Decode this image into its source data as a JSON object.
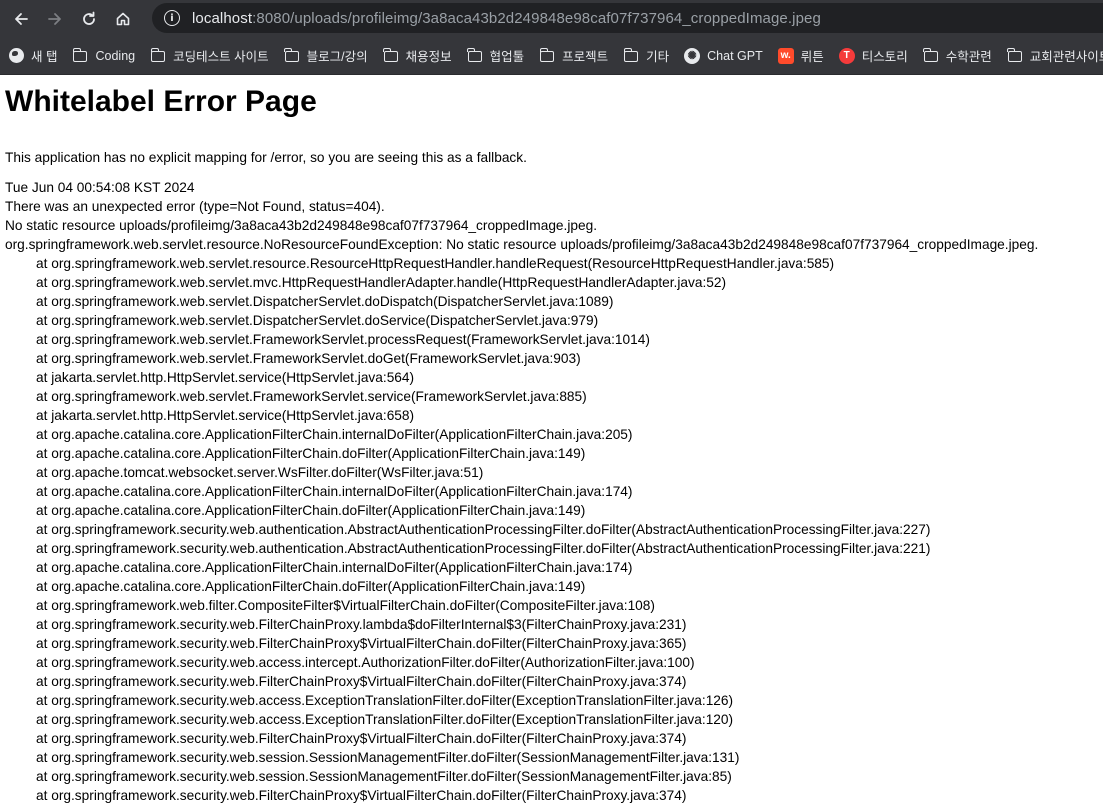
{
  "browser": {
    "url_host": "localhost",
    "url_rest": ":8080/uploads/profileimg/3a8aca43b2d249848e98caf07f737964_croppedImage.jpeg",
    "bookmarks": [
      {
        "label": "새 탭",
        "icon": "globe-icon"
      },
      {
        "label": "Coding",
        "icon": "folder-icon"
      },
      {
        "label": "코딩테스트 사이트",
        "icon": "folder-icon"
      },
      {
        "label": "블로그/강의",
        "icon": "folder-icon"
      },
      {
        "label": "채용정보",
        "icon": "folder-icon"
      },
      {
        "label": "협업툴",
        "icon": "folder-icon"
      },
      {
        "label": "프로젝트",
        "icon": "folder-icon"
      },
      {
        "label": "기타",
        "icon": "folder-icon"
      },
      {
        "label": "Chat GPT",
        "icon": "chatgpt-icon"
      },
      {
        "label": "뤼튼",
        "icon": "wrtn-icon"
      },
      {
        "label": "티스토리",
        "icon": "tistory-icon"
      },
      {
        "label": "수학관련",
        "icon": "folder-icon"
      },
      {
        "label": "교회관련사이트",
        "icon": "folder-icon"
      }
    ]
  },
  "page": {
    "title": "Whitelabel Error Page",
    "fallback": "This application has no explicit mapping for /error, so you are seeing this as a fallback.",
    "timestamp": "Tue Jun 04 00:54:08 KST 2024",
    "error_line": "There was an unexpected error (type=Not Found, status=404).",
    "message": "No static resource uploads/profileimg/3a8aca43b2d249848e98caf07f737964_croppedImage.jpeg.",
    "exception": "org.springframework.web.servlet.resource.NoResourceFoundException: No static resource uploads/profileimg/3a8aca43b2d249848e98caf07f737964_croppedImage.jpeg.",
    "stack_trace": [
      "at org.springframework.web.servlet.resource.ResourceHttpRequestHandler.handleRequest(ResourceHttpRequestHandler.java:585)",
      "at org.springframework.web.servlet.mvc.HttpRequestHandlerAdapter.handle(HttpRequestHandlerAdapter.java:52)",
      "at org.springframework.web.servlet.DispatcherServlet.doDispatch(DispatcherServlet.java:1089)",
      "at org.springframework.web.servlet.DispatcherServlet.doService(DispatcherServlet.java:979)",
      "at org.springframework.web.servlet.FrameworkServlet.processRequest(FrameworkServlet.java:1014)",
      "at org.springframework.web.servlet.FrameworkServlet.doGet(FrameworkServlet.java:903)",
      "at jakarta.servlet.http.HttpServlet.service(HttpServlet.java:564)",
      "at org.springframework.web.servlet.FrameworkServlet.service(FrameworkServlet.java:885)",
      "at jakarta.servlet.http.HttpServlet.service(HttpServlet.java:658)",
      "at org.apache.catalina.core.ApplicationFilterChain.internalDoFilter(ApplicationFilterChain.java:205)",
      "at org.apache.catalina.core.ApplicationFilterChain.doFilter(ApplicationFilterChain.java:149)",
      "at org.apache.tomcat.websocket.server.WsFilter.doFilter(WsFilter.java:51)",
      "at org.apache.catalina.core.ApplicationFilterChain.internalDoFilter(ApplicationFilterChain.java:174)",
      "at org.apache.catalina.core.ApplicationFilterChain.doFilter(ApplicationFilterChain.java:149)",
      "at org.springframework.security.web.authentication.AbstractAuthenticationProcessingFilter.doFilter(AbstractAuthenticationProcessingFilter.java:227)",
      "at org.springframework.security.web.authentication.AbstractAuthenticationProcessingFilter.doFilter(AbstractAuthenticationProcessingFilter.java:221)",
      "at org.apache.catalina.core.ApplicationFilterChain.internalDoFilter(ApplicationFilterChain.java:174)",
      "at org.apache.catalina.core.ApplicationFilterChain.doFilter(ApplicationFilterChain.java:149)",
      "at org.springframework.web.filter.CompositeFilter$VirtualFilterChain.doFilter(CompositeFilter.java:108)",
      "at org.springframework.security.web.FilterChainProxy.lambda$doFilterInternal$3(FilterChainProxy.java:231)",
      "at org.springframework.security.web.FilterChainProxy$VirtualFilterChain.doFilter(FilterChainProxy.java:365)",
      "at org.springframework.security.web.access.intercept.AuthorizationFilter.doFilter(AuthorizationFilter.java:100)",
      "at org.springframework.security.web.FilterChainProxy$VirtualFilterChain.doFilter(FilterChainProxy.java:374)",
      "at org.springframework.security.web.access.ExceptionTranslationFilter.doFilter(ExceptionTranslationFilter.java:126)",
      "at org.springframework.security.web.access.ExceptionTranslationFilter.doFilter(ExceptionTranslationFilter.java:120)",
      "at org.springframework.security.web.FilterChainProxy$VirtualFilterChain.doFilter(FilterChainProxy.java:374)",
      "at org.springframework.security.web.session.SessionManagementFilter.doFilter(SessionManagementFilter.java:131)",
      "at org.springframework.security.web.session.SessionManagementFilter.doFilter(SessionManagementFilter.java:85)",
      "at org.springframework.security.web.FilterChainProxy$VirtualFilterChain.doFilter(FilterChainProxy.java:374)"
    ]
  }
}
